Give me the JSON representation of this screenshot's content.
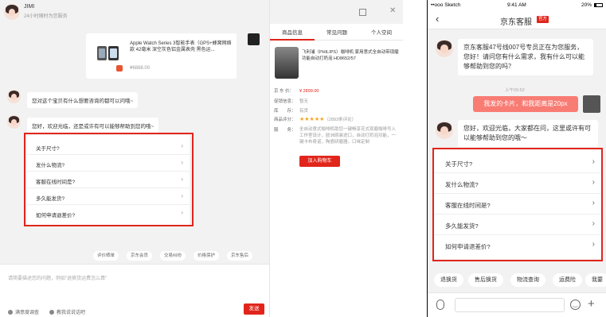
{
  "desktop": {
    "header": {
      "name": "JIMI",
      "subtitle": "24小时随时为您服务"
    },
    "product_card": {
      "title": "Apple Watch Series 3智能手表（GPS+蜂窝网络款 42毫米 深空灰色铝金属表壳 黑色运...",
      "price": "¥6888.00"
    },
    "messages": [
      {
        "text": "您对这个宝贝有什么想要咨询的都可以问哦~"
      },
      {
        "text": "您好，欢迎光临，还是或许有可以能够帮助到您的哦~"
      }
    ],
    "faq": [
      "关于尺寸?",
      "发什么物流?",
      "客服在线时间是?",
      "多久能发货?",
      "如何申请退差价?"
    ],
    "chips": [
      "评价晒单",
      "京东会员",
      "交易纠纷",
      "价格保护",
      "京东售后"
    ],
    "input_placeholder": "请简要描述您的问题，例如\"退换货运费怎么算\"",
    "footer": {
      "satisfaction": "满意度调查",
      "tell": "教我说说话吧",
      "send": "发送"
    }
  },
  "info_panel": {
    "tabs": [
      "商品信息",
      "常见问题",
      "个人空间"
    ],
    "active_tab": 0,
    "product_title": "飞利浦（PHILIPS）咖啡机 家用意式全自动带现磨功能自动打奶泡 HD8652/57",
    "price_label": "京 东 价：",
    "price": "¥ 2899.00",
    "promo_label": "促销信息：",
    "promo_value": "暂无",
    "stock_label": "库　　存：",
    "stock_value": "有货",
    "rating_label": "商品评分：",
    "stars": "★★★★★",
    "rating_count": "（2893条评论）",
    "service_label": "服　　务：",
    "service_text": "全自动意式咖啡机助您一键畅享花式现磨咖啡写入工作室设计，欧洲原装进口，自动打奶泡功能，一键卡布奇诺，陶瓷研磨器，口味定制",
    "cart_button": "加入购物车"
  },
  "mobile": {
    "status": {
      "carrier": "••ooo Sketch",
      "time": "9:41 AM",
      "battery": "20%"
    },
    "nav": {
      "back": "‹",
      "title": "京东客服",
      "badge": "官方"
    },
    "greeting": "京东客服47号线007号专员正在为您服务，您好！请问您有什么需求，我有什么可以能够帮助到您的吗？",
    "time_label": "上午09:52",
    "my_message": "我发的卡片，和我距离是20px",
    "reply": "您好，欢迎光临，大家都在问，这里或许有可以能够帮助到您的哦～",
    "faq": [
      "关于尺寸?",
      "发什么物流?",
      "客服在线时间是?",
      "多久能发货?",
      "如何申请退差价?"
    ],
    "chips": [
      "退换货",
      "售后换货",
      "物流查询",
      "运费险",
      "我要"
    ]
  }
}
